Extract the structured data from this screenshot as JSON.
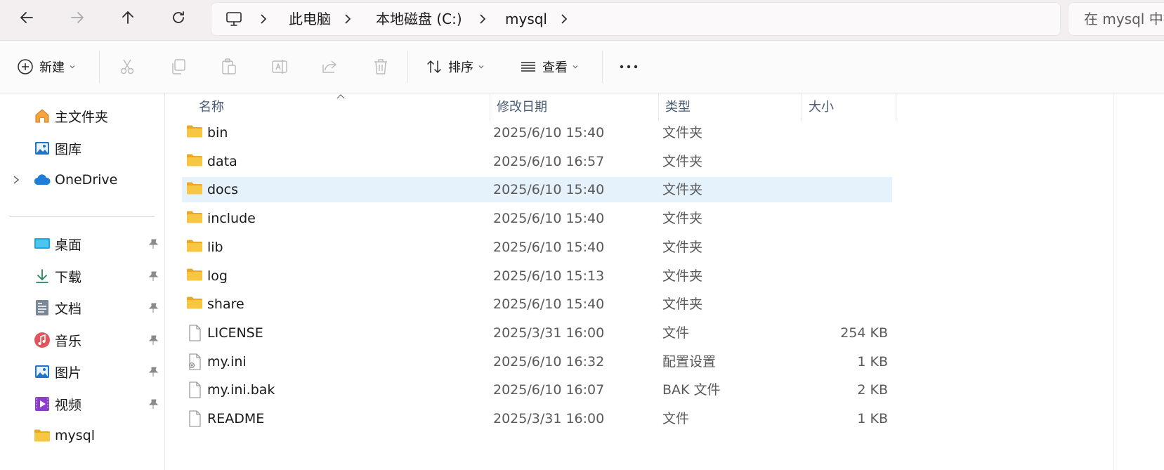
{
  "address_bar": {
    "breadcrumbs": [
      "此电脑",
      "本地磁盘 (C:)",
      "mysql"
    ],
    "search_placeholder": "在 mysql 中搜索"
  },
  "toolbar": {
    "new_label": "新建",
    "sort_label": "排序",
    "view_label": "查看"
  },
  "sidebar": {
    "top_items": [
      {
        "label": "主文件夹",
        "icon": "home-icon"
      },
      {
        "label": "图库",
        "icon": "gallery-icon"
      },
      {
        "label": "OneDrive",
        "icon": "onedrive-icon"
      }
    ],
    "quick_access": [
      {
        "label": "桌面",
        "icon": "desktop-icon",
        "pinned": true
      },
      {
        "label": "下载",
        "icon": "download-icon",
        "pinned": true
      },
      {
        "label": "文档",
        "icon": "documents-icon",
        "pinned": true
      },
      {
        "label": "音乐",
        "icon": "music-icon",
        "pinned": true
      },
      {
        "label": "图片",
        "icon": "pictures-icon",
        "pinned": true
      },
      {
        "label": "视频",
        "icon": "videos-icon",
        "pinned": true
      },
      {
        "label": "mysql",
        "icon": "folder-icon",
        "pinned": false
      }
    ]
  },
  "list": {
    "columns": {
      "name": "名称",
      "date": "修改日期",
      "type": "类型",
      "size": "大小"
    },
    "rows": [
      {
        "name": "bin",
        "date": "2025/6/10 15:40",
        "type": "文件夹",
        "size": "",
        "icon": "folder-icon"
      },
      {
        "name": "data",
        "date": "2025/6/10 16:57",
        "type": "文件夹",
        "size": "",
        "icon": "folder-icon"
      },
      {
        "name": "docs",
        "date": "2025/6/10 15:40",
        "type": "文件夹",
        "size": "",
        "icon": "folder-icon",
        "selected": true
      },
      {
        "name": "include",
        "date": "2025/6/10 15:40",
        "type": "文件夹",
        "size": "",
        "icon": "folder-icon"
      },
      {
        "name": "lib",
        "date": "2025/6/10 15:40",
        "type": "文件夹",
        "size": "",
        "icon": "folder-icon"
      },
      {
        "name": "log",
        "date": "2025/6/10 15:13",
        "type": "文件夹",
        "size": "",
        "icon": "folder-icon"
      },
      {
        "name": "share",
        "date": "2025/6/10 15:40",
        "type": "文件夹",
        "size": "",
        "icon": "folder-icon"
      },
      {
        "name": "LICENSE",
        "date": "2025/3/31 16:00",
        "type": "文件",
        "size": "254 KB",
        "icon": "file-icon"
      },
      {
        "name": "my.ini",
        "date": "2025/6/10 16:32",
        "type": "配置设置",
        "size": "1 KB",
        "icon": "config-file-icon"
      },
      {
        "name": "my.ini.bak",
        "date": "2025/6/10 16:07",
        "type": "BAK 文件",
        "size": "2 KB",
        "icon": "file-icon"
      },
      {
        "name": "README",
        "date": "2025/3/31 16:00",
        "type": "文件",
        "size": "1 KB",
        "icon": "file-icon"
      }
    ]
  },
  "colors": {
    "folder": "#f7c643",
    "selection": "#e5f1fb",
    "chrome_bg": "#f3eff0",
    "onedrive": "#1d7ed8"
  }
}
